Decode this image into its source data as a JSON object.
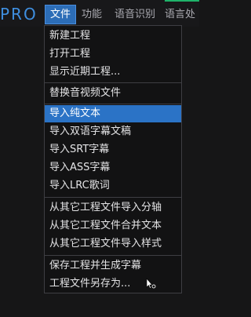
{
  "brand": "PRO",
  "menubar": {
    "items": [
      {
        "label": "文件"
      },
      {
        "label": "功能"
      },
      {
        "label": "语音识别"
      },
      {
        "label": "语言处"
      }
    ]
  },
  "dropdown": {
    "items": [
      {
        "label": "新建工程"
      },
      {
        "label": "打开工程"
      },
      {
        "label": "显示近期工程..."
      },
      {
        "label": "替换音视频文件"
      },
      {
        "label": "导入纯文本"
      },
      {
        "label": "导入双语字幕文稿"
      },
      {
        "label": "导入SRT字幕"
      },
      {
        "label": "导入ASS字幕"
      },
      {
        "label": "导入LRC歌词"
      },
      {
        "label": "从其它工程文件导入分轴"
      },
      {
        "label": "从其它工程文件合并文本"
      },
      {
        "label": "从其它工程文件导入样式"
      },
      {
        "label": "保存工程并生成字幕"
      },
      {
        "label": "工程文件另存为..."
      }
    ]
  },
  "colors": {
    "accent": "#2b73c6",
    "brand": "#3f8fe0",
    "background": "#161617"
  }
}
